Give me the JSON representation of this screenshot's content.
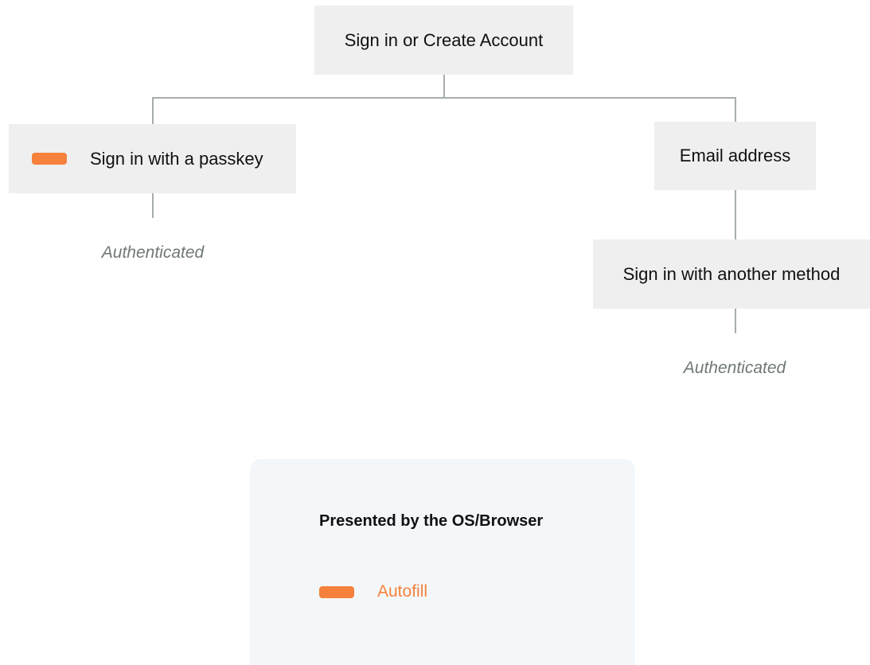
{
  "diagram": {
    "root": {
      "label": "Sign in or Create Account"
    },
    "passkey_branch": {
      "label": "Sign in with a passkey",
      "marker": "orange-pill-icon",
      "outcome": "Authenticated"
    },
    "email_branch": {
      "label": "Email address",
      "child": {
        "label": "Sign in with another method"
      },
      "outcome": "Authenticated"
    },
    "legend": {
      "title": "Presented by the OS/Browser",
      "items": [
        {
          "marker": "orange-pill-icon",
          "label": "Autofill"
        }
      ]
    },
    "colors": {
      "accent": "#f5813c",
      "node_bg": "#efefef",
      "connector": "#a7adad",
      "legend_bg": "#f4f7f9",
      "outcome_text": "#6f7876"
    }
  }
}
